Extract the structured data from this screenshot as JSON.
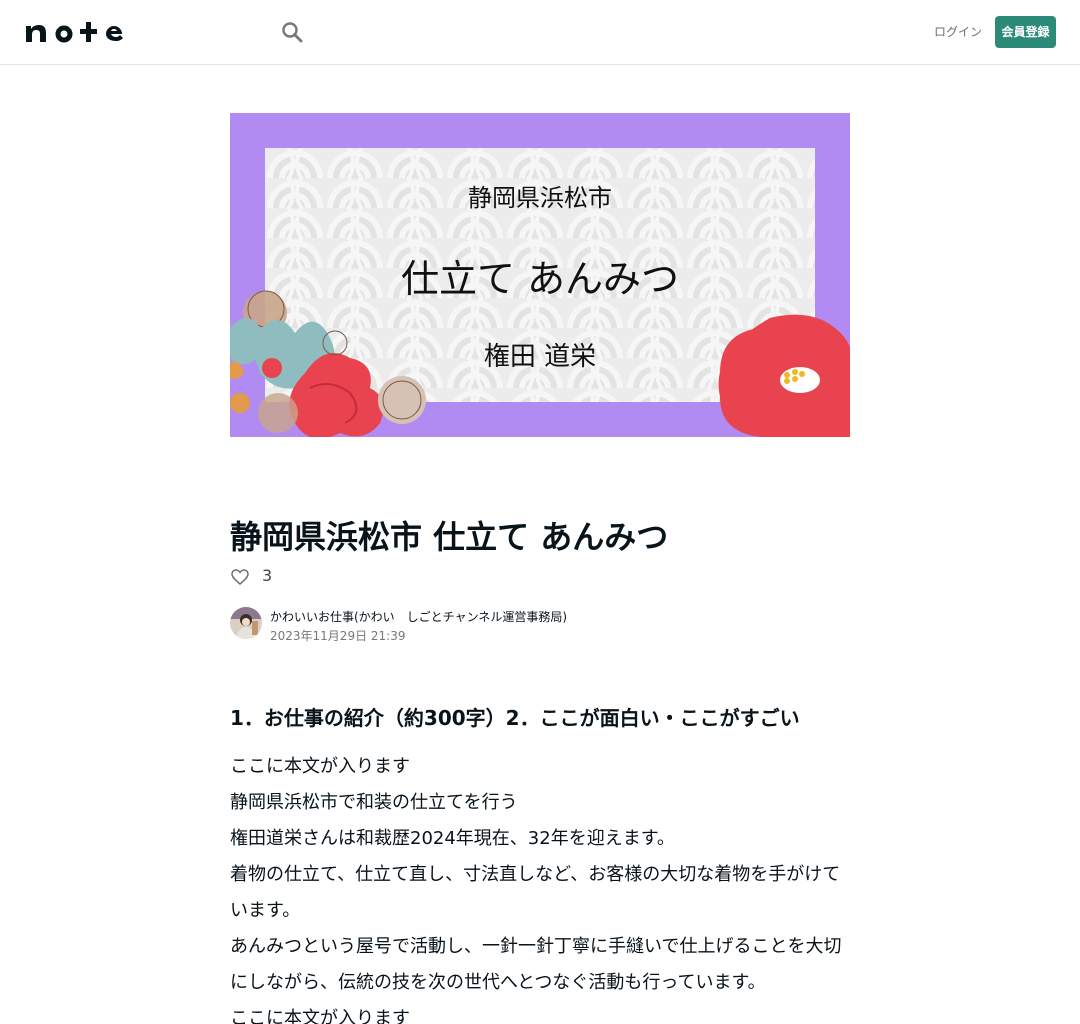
{
  "header": {
    "logo_text": "note",
    "login_label": "ログイン",
    "signup_label": "会員登録",
    "accent_color": "#2b8b78"
  },
  "hero": {
    "line1": "静岡県浜松市",
    "line2": "仕立て あんみつ",
    "line3": "権田 道栄",
    "frame_color": "#b18bf2"
  },
  "article": {
    "title": "静岡県浜松市 仕立て あんみつ",
    "like_count": "3",
    "author_name": "かわいいお仕事(かわい　しごとチャンネル運営事務局)",
    "date": "2023年11月29日 21:39",
    "heading": "1．お仕事の紹介（約300字）2．ここが面白い・ここがすごい",
    "paragraphs": [
      "ここに本文が入ります",
      "静岡県浜松市で和装の仕立てを行う",
      "権田道栄さんは和裁歴2024年現在、32年を迎えます。",
      "着物の仕立て、仕立て直し、寸法直しなど、お客様の大切な着物を手がけています。",
      "あんみつという屋号で活動し、一針一針丁寧に手縫いで仕上げることを大切にしながら、伝統の技を次の世代へとつなぐ活動も行っています。",
      "ここに本文が入ります"
    ]
  }
}
